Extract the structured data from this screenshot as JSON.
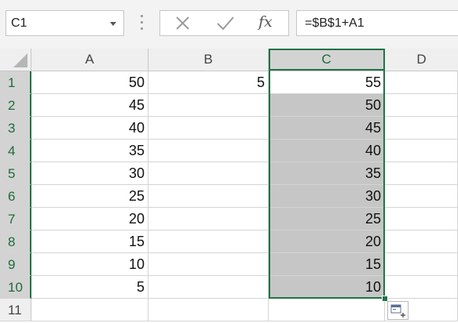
{
  "formula_bar": {
    "name_box": "C1",
    "cancel_icon": "x-icon",
    "enter_icon": "check-icon",
    "fx_label": "fx",
    "formula": "=$B$1+A1"
  },
  "columns": [
    "A",
    "B",
    "C",
    "D"
  ],
  "rows": [
    {
      "num": "1",
      "A": "50",
      "B": "5",
      "C": "55"
    },
    {
      "num": "2",
      "A": "45",
      "B": "",
      "C": "50"
    },
    {
      "num": "3",
      "A": "40",
      "B": "",
      "C": "45"
    },
    {
      "num": "4",
      "A": "35",
      "B": "",
      "C": "40"
    },
    {
      "num": "5",
      "A": "30",
      "B": "",
      "C": "35"
    },
    {
      "num": "6",
      "A": "25",
      "B": "",
      "C": "30"
    },
    {
      "num": "7",
      "A": "20",
      "B": "",
      "C": "25"
    },
    {
      "num": "8",
      "A": "15",
      "B": "",
      "C": "20"
    },
    {
      "num": "9",
      "A": "10",
      "B": "",
      "C": "15"
    },
    {
      "num": "10",
      "A": "5",
      "B": "",
      "C": "10"
    },
    {
      "num": "11",
      "A": "",
      "B": "",
      "C": ""
    }
  ],
  "selection": {
    "range": "C1:C10",
    "active_cell": "C1",
    "accent": "#217346"
  }
}
